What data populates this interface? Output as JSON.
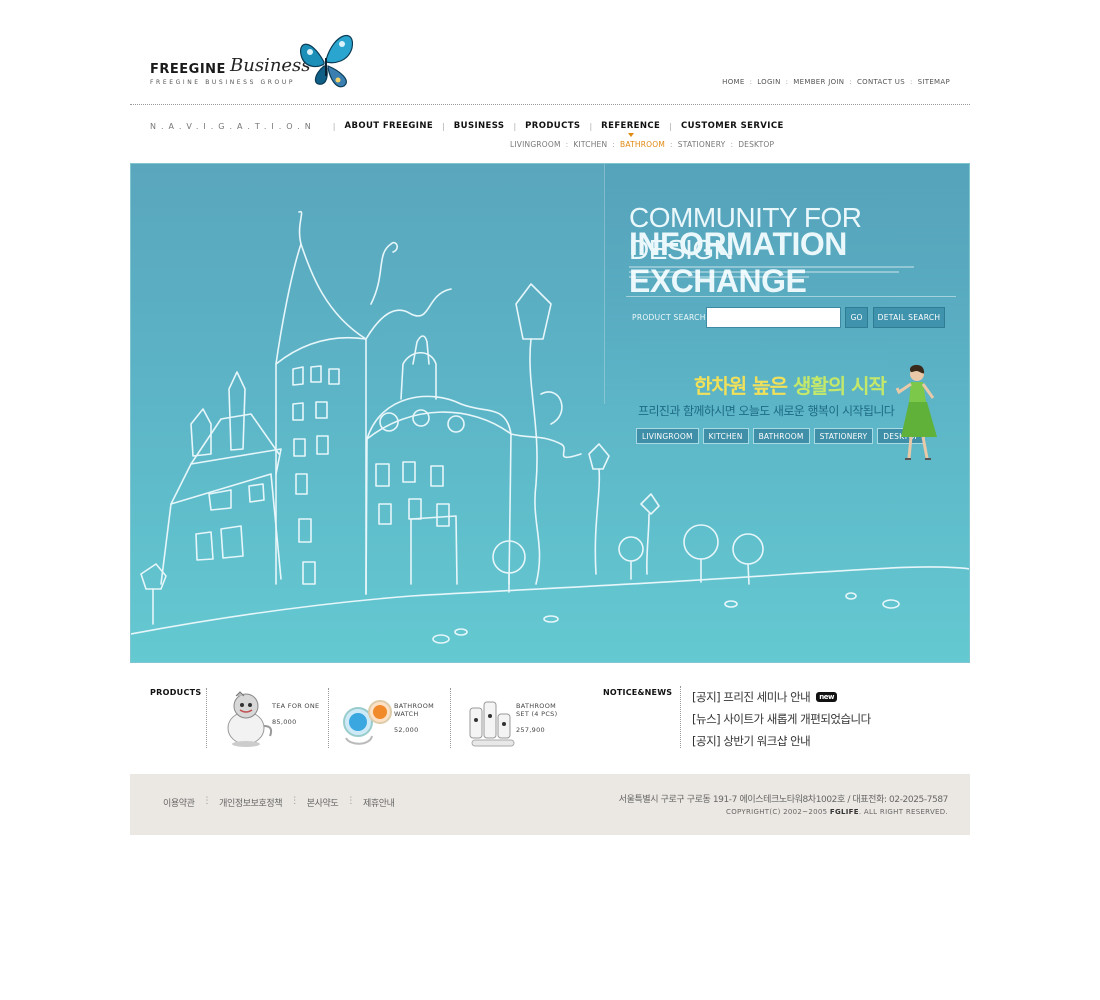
{
  "header": {
    "brand": "FREEGINE",
    "brand_script": "Business",
    "tagline": "FREEGINE BUSINESS GROUP",
    "top_links": [
      "HOME",
      "LOGIN",
      "MEMBER JOIN",
      "CONTACT US",
      "SITEMAP"
    ]
  },
  "nav": {
    "label": "N.A.V.I.G.A.T.I.O.N",
    "items": [
      "ABOUT FREEGINE",
      "BUSINESS",
      "PRODUCTS",
      "REFERENCE",
      "CUSTOMER SERVICE"
    ],
    "active_item": "REFERENCE",
    "sub_items": [
      "LIVINGROOM",
      "KITCHEN",
      "BATHROOM",
      "STATIONERY",
      "DESKTOP"
    ],
    "active_sub": "BATHROOM"
  },
  "hero": {
    "headline_1": "COMMUNITY FOR DESIGN",
    "headline_2": "INFORMATION EXCHANGE",
    "search_label": "PRODUCT SEARCH",
    "search_value": "",
    "go_label": "GO",
    "detail_label": "DETAIL SEARCH",
    "slogan_1a": "한차원 높은 ",
    "slogan_1b": "생활의 시작",
    "slogan_2": "프리진과 함께하시면 오늘도 새로운 행복이 시작됩니다",
    "categories": [
      "LIVINGROOM",
      "KITCHEN",
      "BATHROOM",
      "STATIONERY",
      "DESKTOP"
    ]
  },
  "products": {
    "title": "PRODUCTS",
    "items": [
      {
        "name": "TEA FOR ONE",
        "price": "85,000",
        "icon": "teapot-icon"
      },
      {
        "name": "BATHROOM\nWATCH",
        "price": "52,000",
        "icon": "bathroom-watch-icon"
      },
      {
        "name": "BATHROOM\nSET (4 PCS)",
        "price": "257,900",
        "icon": "bathroom-set-icon"
      }
    ]
  },
  "notice": {
    "title": "NOTICE&NEWS",
    "items": [
      "[공지] 프리진 세미나 안내",
      "[뉴스] 사이트가 새롭게 개편되었습니다",
      "[공지] 상반기 워크샵 안내"
    ],
    "new_badge": "new"
  },
  "footer": {
    "links": [
      "이용약관",
      "개인정보보호정책",
      "본사약도",
      "제휴안내"
    ],
    "address": "서울특별시 구로구 구로동 191-7 에이스테크노타워8차1002호 / 대표전화: 02-2025-7587",
    "copyright_prefix": "COPYRIGHT(C) 2002~2005 ",
    "copyright_brand": "FGLIFE",
    "copyright_suffix": ". ALL RIGHT RESERVED."
  },
  "colors": {
    "hero_bg": "#5cb4c6",
    "accent_orange": "#e08a12",
    "footer_bg": "#ebe8e3",
    "button_blue": "#3f93ad"
  }
}
